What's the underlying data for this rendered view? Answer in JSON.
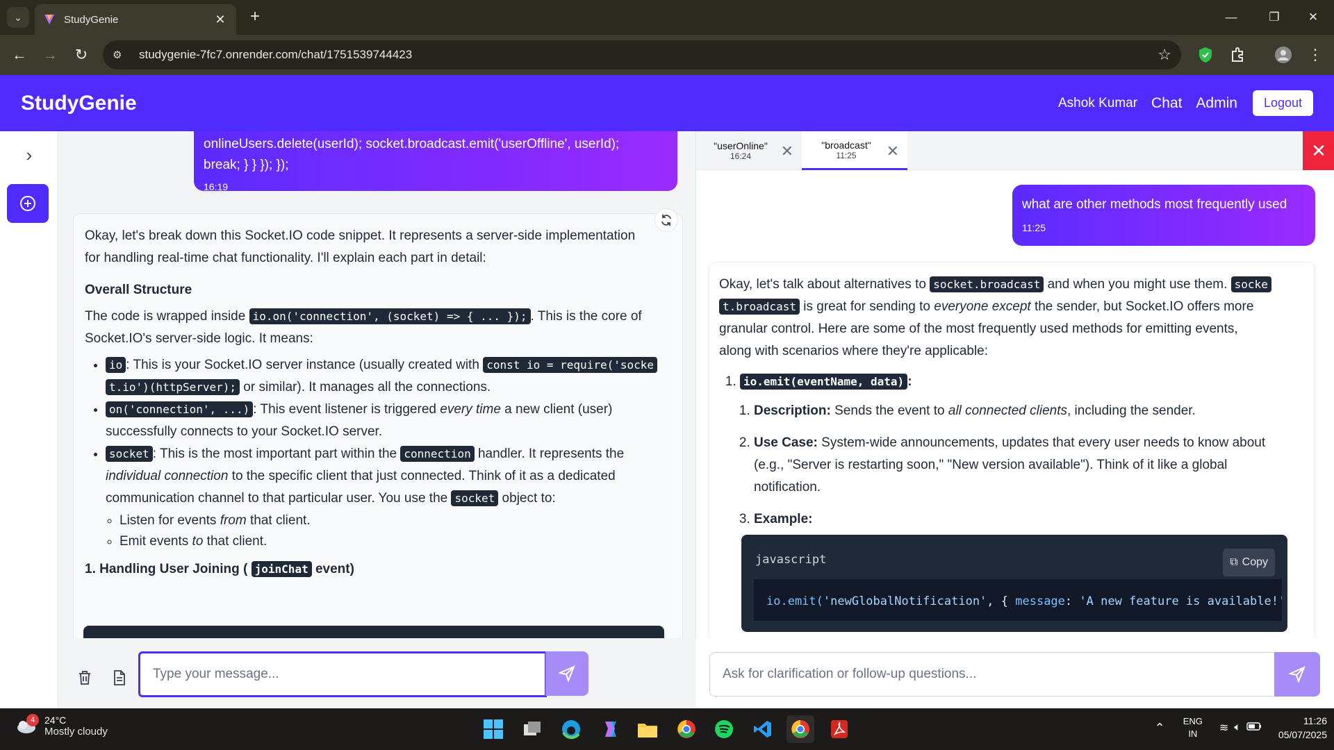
{
  "browser": {
    "tab_title": "StudyGenie",
    "url": "studygenie-7fc7.onrender.com/chat/1751539744423"
  },
  "header": {
    "brand": "StudyGenie",
    "user_name": "Ashok Kumar",
    "nav_chat": "Chat",
    "nav_admin": "Admin",
    "logout": "Logout",
    "brand_color": "#4f2bff"
  },
  "main_chat": {
    "user_message": {
      "text_line1": "onlineUsers.delete(userId); socket.broadcast.emit('userOffline', userId);",
      "text_line2": "break; } } }); });",
      "time": "16:19"
    },
    "ai_message": {
      "intro_p1": "Okay, let's break down this Socket.IO code snippet. It represents a server-side implementation",
      "intro_p2": "for handling real-time chat functionality. I'll explain each part in detail:",
      "heading_overall": "Overall Structure",
      "wrap_pre": "The code is wrapped inside ",
      "wrap_code": "io.on('connection', (socket) => { ... });",
      "wrap_post": ". This is the core of",
      "wrap_line2": "Socket.IO's server-side logic. It means:",
      "b1_code": "io",
      "b1_text": ": This is your Socket.IO server instance (usually created with ",
      "b1_code2a": "const io = require('socke",
      "b1_code2b": "t.io')(httpServer);",
      "b1_post": " or similar). It manages all the connections.",
      "b2_code": "on('connection', ...)",
      "b2_text": ": This event listener is triggered ",
      "b2_em": "every time",
      "b2_post": " a new client (user)",
      "b2_line2": "successfully connects to your Socket.IO server.",
      "b3_code": "socket",
      "b3_text": ": This is the most important part within the ",
      "b3_code2": "connection",
      "b3_post": " handler. It represents the",
      "b3_em": "individual connection",
      "b3_line2": " to the specific client that just connected. Think of it as a dedicated",
      "b3_line3": "communication channel to that particular user. You use the ",
      "b3_code3": "socket",
      "b3_line3_post": " object to:",
      "sub1_pre": "Listen for events ",
      "sub1_em": "from",
      "sub1_post": " that client.",
      "sub2_pre": "Emit events ",
      "sub2_em": "to",
      "sub2_post": " that client.",
      "heading_join_pre": "1. Handling User Joining ( ",
      "heading_join_code": "joinChat",
      "heading_join_post": " event)"
    },
    "input_placeholder": "Type your message..."
  },
  "right_panel": {
    "tabs": [
      {
        "title": "\"userOnline\"",
        "time": "16:24"
      },
      {
        "title": "\"broadcast\"",
        "time": "11:25"
      }
    ],
    "user_message": {
      "text": "what are other methods most frequently used",
      "time": "11:25"
    },
    "ai_message": {
      "p1_pre": "Okay, let's talk about alternatives to ",
      "p1_code": "socket.broadcast",
      "p1_mid": " and when you might use them. ",
      "p1_code2a": "socke",
      "p1_code2b": "t.broadcast",
      "p1_post": " is great for sending to ",
      "p1_em": "everyone except",
      "p1_post2": " the sender, but Socket.IO offers more",
      "p1_line3": "granular control. Here are some of the most frequently used methods for emitting events,",
      "p1_line4": "along with scenarios where they're applicable:",
      "item1_code": "io.emit(eventName, data)",
      "desc_label": "Description:",
      "desc_pre": " Sends the event to ",
      "desc_em": "all connected clients",
      "desc_post": ", including the sender.",
      "use_label": "Use Case:",
      "use_text1": " System-wide announcements, updates that every user needs to know about",
      "use_text2": "(e.g., \"Server is restarting soon,\" \"New version available\"). Think of it like a global",
      "use_text3": "notification.",
      "example_label": "Example:",
      "code_lang": "javascript",
      "copy_label": "Copy",
      "code_fn": "io.emit(",
      "code_str1": "'newGlobalNotification'",
      "code_mid": ", { ",
      "code_key": "message",
      "code_colon": ": ",
      "code_str2": "'A new feature is available!'",
      "code_end": " })"
    },
    "input_placeholder": "Ask for clarification or follow-up questions..."
  },
  "taskbar": {
    "weather_badge": "4",
    "temp": "24°C",
    "condition": "Mostly cloudy",
    "lang1": "ENG",
    "lang2": "IN",
    "time": "11:26",
    "date": "05/07/2025"
  }
}
